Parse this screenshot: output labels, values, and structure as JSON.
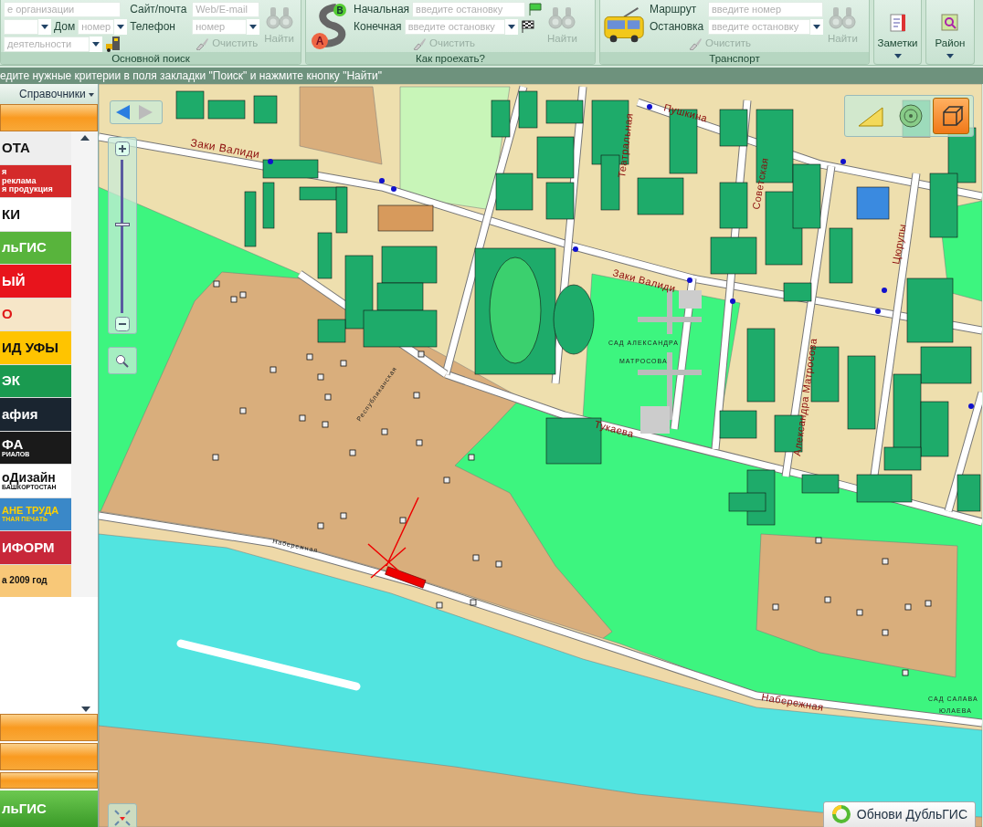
{
  "ribbon": {
    "main_search": {
      "title": "Основной поиск",
      "org_field": {
        "placeholder": "е организации"
      },
      "house_label": "Дом",
      "house_field": {
        "placeholder": "номер"
      },
      "activity_field": {
        "placeholder": "деятельности"
      },
      "site_label": "Сайт/почта",
      "site_field": {
        "placeholder": "Web/E-mail"
      },
      "phone_label": "Телефон",
      "phone_field": {
        "placeholder": "номер"
      },
      "clear_button": {
        "label": "Очистить",
        "disabled": true
      },
      "find_button": {
        "label": "Найти",
        "disabled": true
      }
    },
    "route": {
      "title": "Как проехать?",
      "marker_top": "B",
      "marker_bottom": "A",
      "start_label": "Начальная",
      "start_field": {
        "placeholder": "введите остановку"
      },
      "end_label": "Конечная",
      "end_field": {
        "placeholder": "введите остановку"
      },
      "clear_button": {
        "label": "Очистить",
        "disabled": true
      },
      "find_button": {
        "label": "Найти",
        "disabled": true
      }
    },
    "transport": {
      "title": "Транспорт",
      "route_label": "Маршрут",
      "route_field": {
        "placeholder": "введите номер"
      },
      "stop_label": "Остановка",
      "stop_field": {
        "placeholder": "введите остановку"
      },
      "clear_button": {
        "label": "Очистить",
        "disabled": true
      },
      "find_button": {
        "label": "Найти",
        "disabled": true
      }
    },
    "notes_button": "Заметки",
    "district_button": "Район"
  },
  "status_bar": "едите нужные критерии в поля закладки \"Поиск\" и нажмите кнопку \"Найти\"",
  "sidebar": {
    "directory_menu": "Справочники",
    "banners": [
      {
        "lines": [
          "ОТА"
        ],
        "color": "#eeeeee"
      },
      {
        "lines": [
          "я",
          "реклама",
          "я продукция"
        ],
        "color": "#d42a2a"
      },
      {
        "lines": [
          "КИ"
        ],
        "color": "#ffffff"
      },
      {
        "lines": [
          "льГИС"
        ],
        "color": "#58b43c"
      },
      {
        "lines": [
          "ЫЙ"
        ],
        "color": "#e8141c"
      },
      {
        "lines": [
          "О"
        ],
        "color": "#f6e6c8"
      },
      {
        "lines": [
          "ИД УФЫ"
        ],
        "color": "#ffc400"
      },
      {
        "lines": [
          "ЭК"
        ],
        "color": "#1a9a50"
      },
      {
        "lines": [
          "афия"
        ],
        "color": "#1a2530"
      },
      {
        "lines": [
          "ФА",
          "РИАЛОВ"
        ],
        "color": "#1a1a1a"
      },
      {
        "lines": [
          "оДизайн",
          "БАШКОРТОСТАН"
        ],
        "color": "#ffffff"
      },
      {
        "lines": [
          "АНЕ ТРУДА",
          "ТНАЯ ПЕЧАТЬ"
        ],
        "color": "#3a88c8"
      },
      {
        "lines": [
          "ИФОРМ"
        ],
        "color": "#c8283a"
      },
      {
        "lines": [
          "а 2009 год"
        ],
        "color": "#f8c878"
      }
    ],
    "logo": "льГИС"
  },
  "map": {
    "labels": [
      "Заки Валиди",
      "Пушкина",
      "Театральная",
      "Советская",
      "Цюрупы",
      "Заки Валиди",
      "Тукаева",
      "Александра Матросова",
      "САД АЛЕКСАНДРА",
      "МАТРОСОВА",
      "Набережная",
      "САД САЛАВА",
      "ЮЛАЕВА",
      "Набережная",
      "Республиканская"
    ],
    "zoom": {
      "level": 0.58
    },
    "tools": [
      {
        "selected": false
      },
      {
        "selected": false
      },
      {
        "selected": true
      }
    ],
    "update_button": "Обнови ДубльГИС"
  }
}
